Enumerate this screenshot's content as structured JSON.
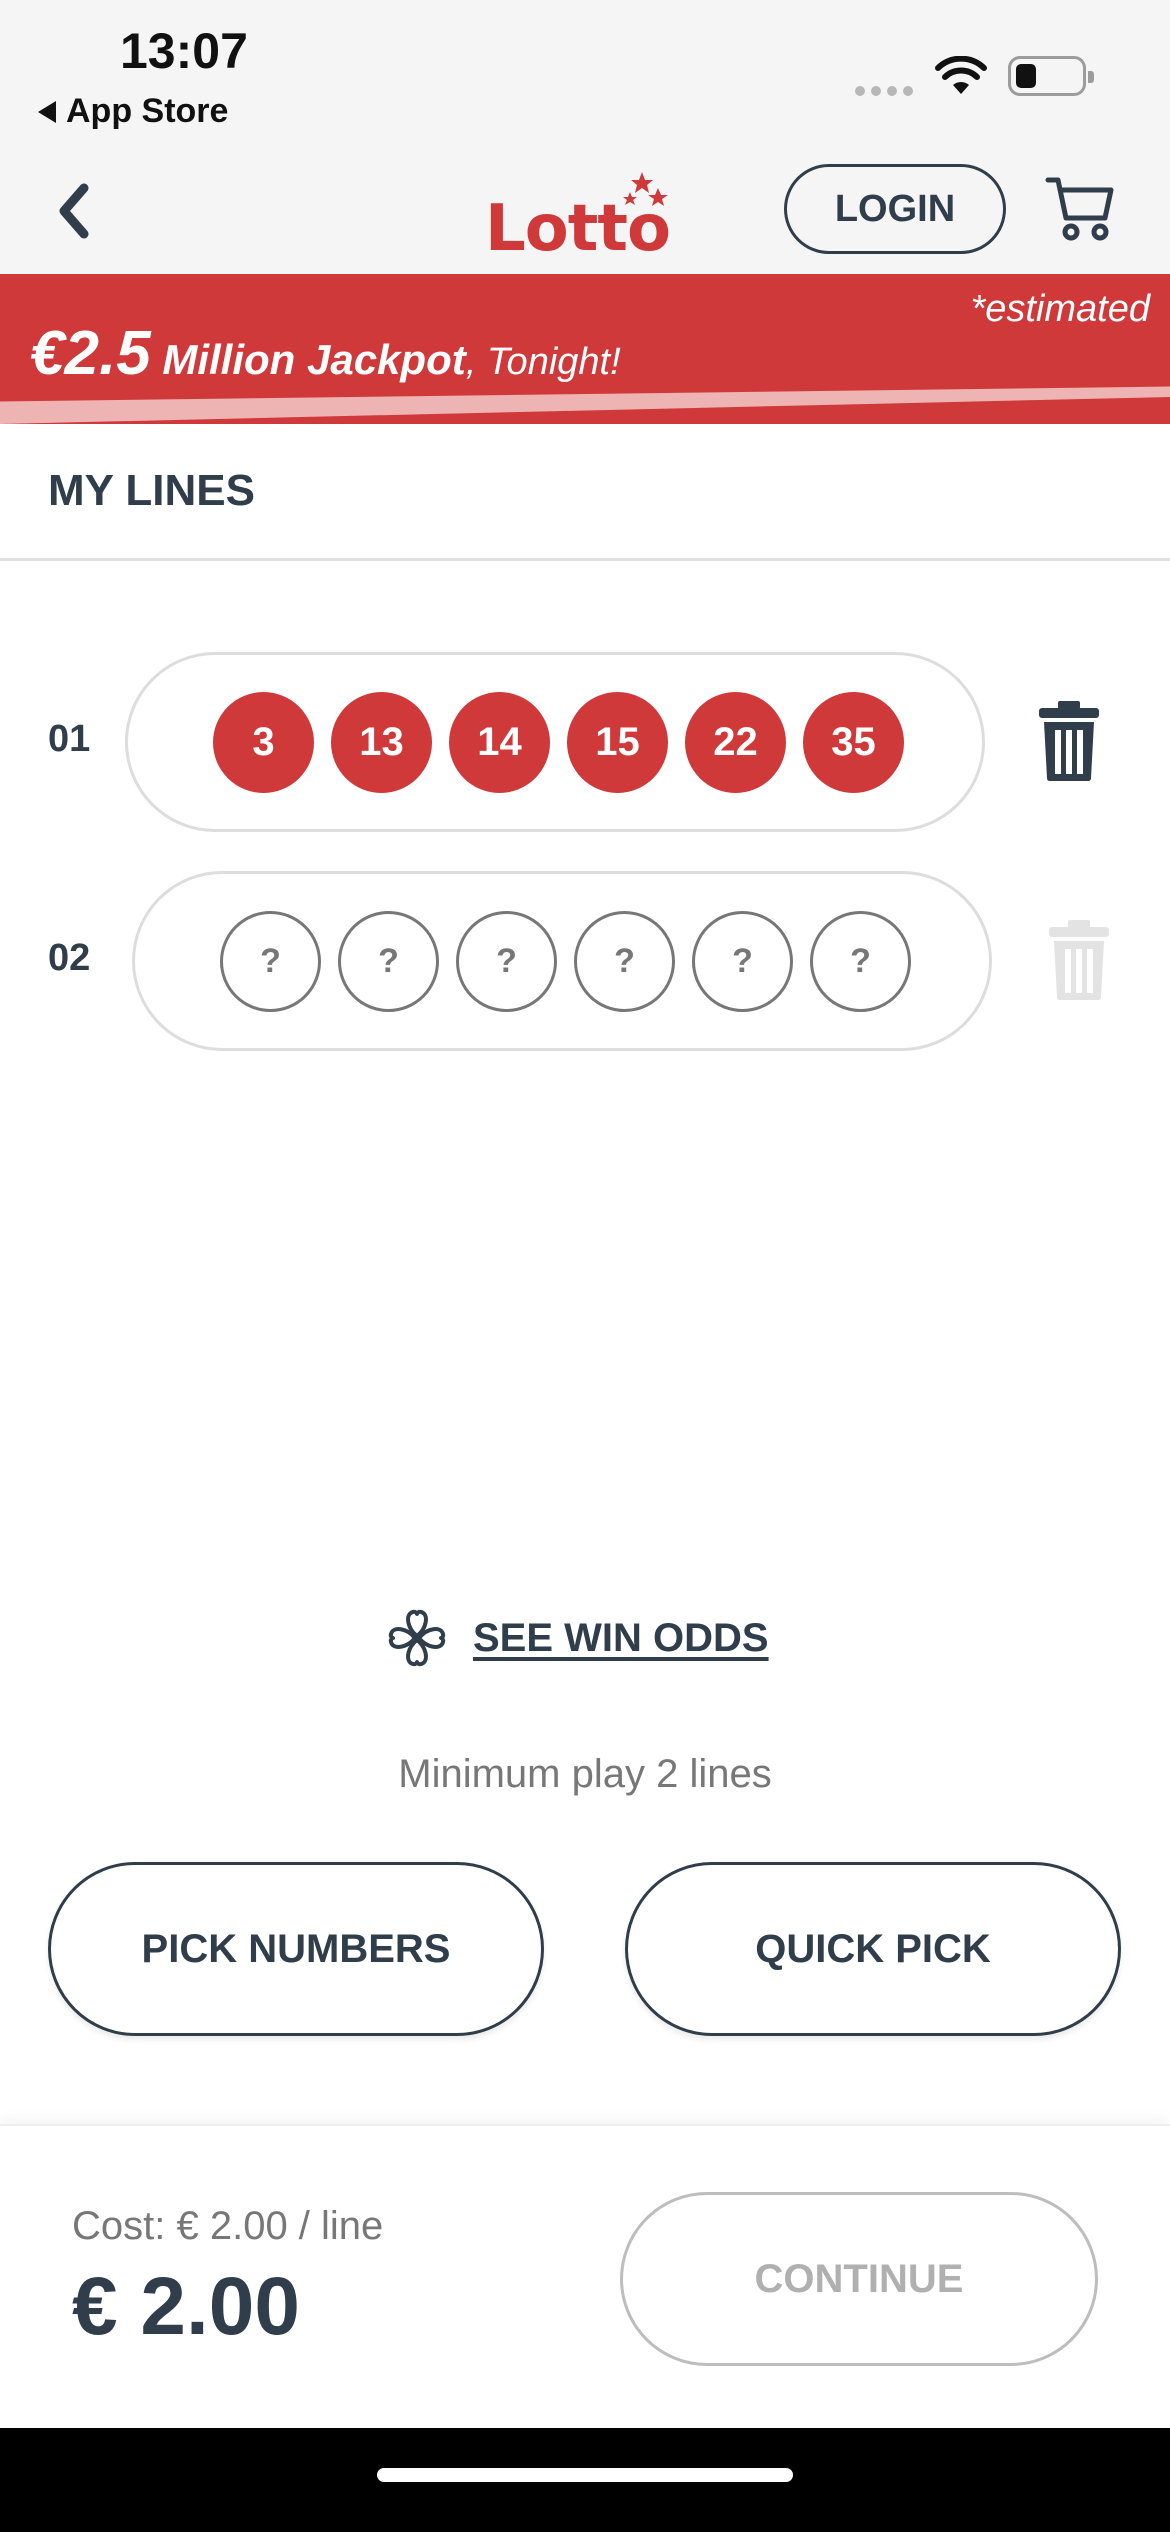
{
  "status_bar": {
    "time": "13:07",
    "back_app_label": "App Store"
  },
  "nav": {
    "logo_text": "Lotto",
    "login_label": "LOGIN"
  },
  "jackpot": {
    "estimated_note": "*estimated",
    "amount": "€2.5",
    "title": " Million Jackpot",
    "suffix": ", Tonight!"
  },
  "section": {
    "title": "MY LINES"
  },
  "lines": [
    {
      "number": "01",
      "balls": [
        "3",
        "13",
        "14",
        "15",
        "22",
        "35"
      ],
      "filled": true
    },
    {
      "number": "02",
      "balls": [
        "?",
        "?",
        "?",
        "?",
        "?",
        "?"
      ],
      "filled": false
    }
  ],
  "odds": {
    "label": "SEE WIN ODDS"
  },
  "play": {
    "minimum_text": "Minimum play 2 lines",
    "pick_numbers_label": "PICK NUMBERS",
    "quick_pick_label": "QUICK PICK"
  },
  "footer": {
    "cost_per_line": "Cost: € 2.00 / line",
    "total": "€ 2.00",
    "continue_label": "CONTINUE"
  },
  "colors": {
    "brand_red": "#d0393a",
    "text_dark": "#2f3e4a",
    "muted": "#777777",
    "disabled": "#b0b0b0"
  }
}
